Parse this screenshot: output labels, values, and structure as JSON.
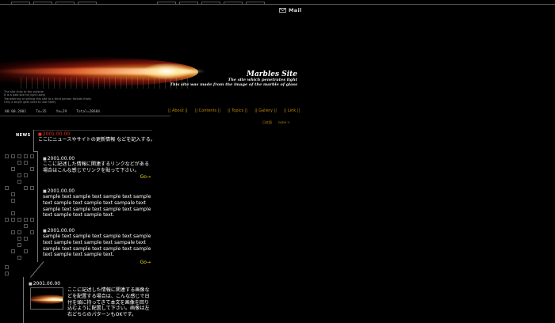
{
  "header": {
    "mail_label": "Mail"
  },
  "banner": {
    "title": "Marbles Site",
    "subtitle1": "The site which penetrates light",
    "subtitle2": "This site was made from the image of the marble of glass",
    "notes": [
      "The site links to the outside",
      "It is a web site for light users",
      "Transferring or selling this site to a third person forbids freely",
      "Only a buyer gets used to use freely"
    ]
  },
  "status": {
    "date": "00.00.2001",
    "to": "To=35",
    "ye": "Ye=29",
    "total": "Total=28684"
  },
  "nav": {
    "items": [
      "|| About ||",
      "|| Contents ||",
      "|| Topics ||",
      "|| Gallery ||",
      "|| Link ||"
    ]
  },
  "lang": {
    "jp": "日本語",
    "en": "none >"
  },
  "news": {
    "label": "NEWS",
    "head_date": "2001.00.00",
    "head_text": "ここにニュースやサイトの更新情報 などを記入する。",
    "entries": [
      {
        "date": "2001.00.00",
        "text": "ここに記述した情報に関連するリンクなどがある場合はこんな感じでリンクを貼って下さい。",
        "go": "Go→"
      },
      {
        "date": "2001.00.00",
        "text": "sample text sample text sample text sample text sample text sample text sampale text sample text sample text sample text sample text sample text sample text.",
        "go": ""
      },
      {
        "date": "2001.00.00",
        "text": "sample text sample text sample text sample text sample text sample text sampale text sample text sample text sample text sample text sample text sample text.",
        "go": "Go→"
      },
      {
        "date": "2001.00.00",
        "text": "ここに記述した情報に関連する画像などを配置する場合は、こんな感じで日付を頭に持ってきて本文を画像を回り込むように配置して下さい。画像は左右どちらのパターンもOKです。",
        "go": ""
      }
    ]
  },
  "colors": {
    "accent_gold": "#b8860b",
    "go_yellow": "#e8d22a",
    "news_red": "#e32"
  }
}
